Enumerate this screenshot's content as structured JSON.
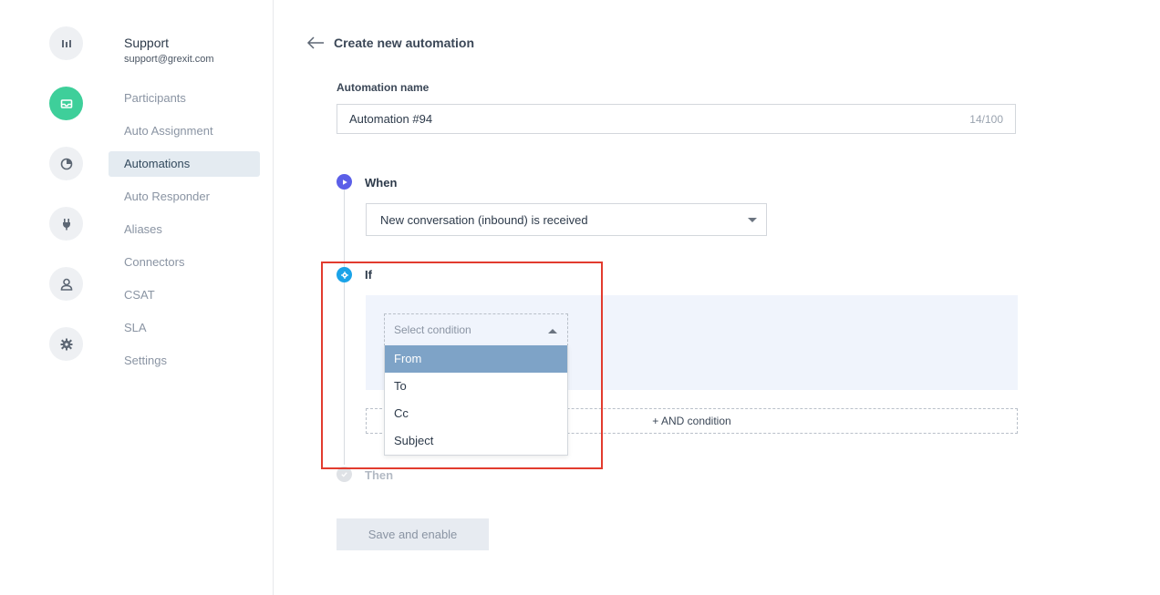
{
  "team": {
    "name": "Support",
    "email": "support@grexit.com"
  },
  "rail_icons": [
    "analytics-icon",
    "inbox-icon",
    "reports-icon",
    "integrations-plug-icon",
    "user-icon",
    "gear-icon"
  ],
  "nav": {
    "items": [
      {
        "label": "Participants",
        "active": false
      },
      {
        "label": "Auto Assignment",
        "active": false
      },
      {
        "label": "Automations",
        "active": true
      },
      {
        "label": "Auto Responder",
        "active": false
      },
      {
        "label": "Aliases",
        "active": false
      },
      {
        "label": "Connectors",
        "active": false
      },
      {
        "label": "CSAT",
        "active": false
      },
      {
        "label": "SLA",
        "active": false
      },
      {
        "label": "Settings",
        "active": false
      }
    ]
  },
  "page": {
    "title": "Create new automation"
  },
  "automation_name": {
    "label": "Automation name",
    "value": "Automation #94",
    "counter": "14/100"
  },
  "when": {
    "label": "When",
    "selected": "New conversation (inbound) is received"
  },
  "if": {
    "label": "If",
    "condition_placeholder": "Select condition",
    "options": [
      "From",
      "To",
      "Cc",
      "Subject"
    ],
    "highlighted_option": "From",
    "add_condition_label": "+ AND condition"
  },
  "then": {
    "label": "Then"
  },
  "actions": {
    "save_label": "Save and enable"
  },
  "colors": {
    "accent_green": "#3ecf9a",
    "when_dot": "#5b5fe8",
    "if_dot": "#1aa3e8",
    "highlight_option": "#7ea3c7",
    "highlight_border": "#e23b2e"
  }
}
